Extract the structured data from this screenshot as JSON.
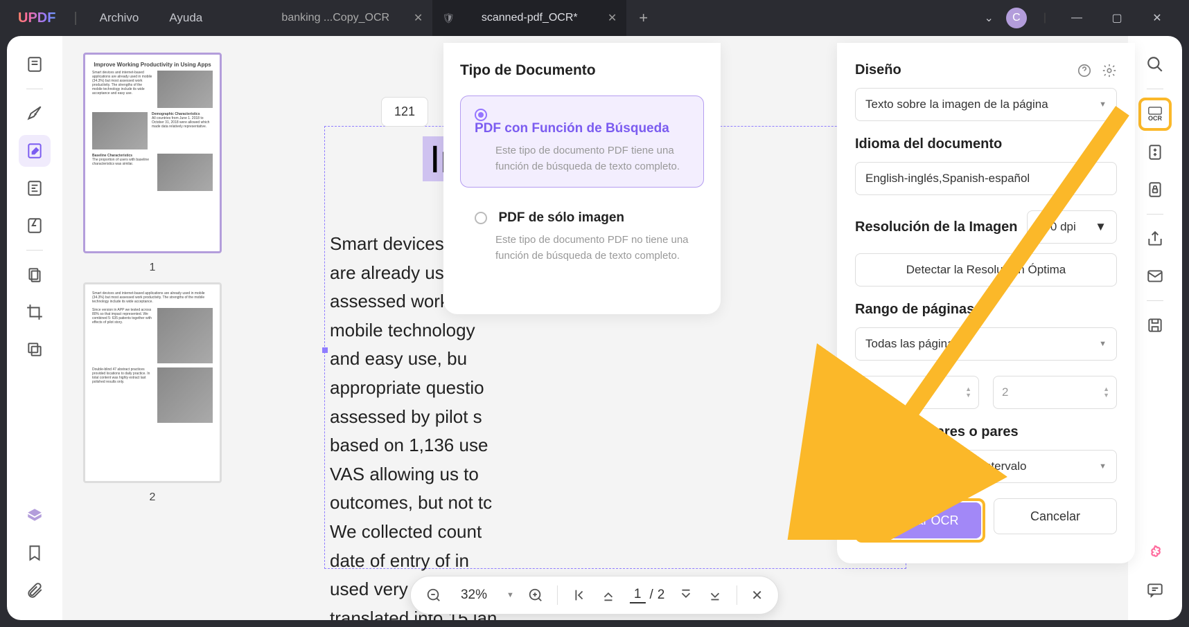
{
  "titlebar": {
    "logo": "UPDF",
    "menu": {
      "file": "Archivo",
      "help": "Ayuda"
    },
    "tabs": [
      {
        "label": "banking ...Copy_OCR",
        "active": false
      },
      {
        "label": "scanned-pdf_OCR*",
        "active": true
      }
    ],
    "avatar": "C"
  },
  "thumbnails": [
    {
      "page": "1",
      "title": "Improve Working Productivity in Using Apps"
    },
    {
      "page": "2",
      "title": ""
    }
  ],
  "document": {
    "page_badge": "121",
    "heading": "Im",
    "body": "Smart devices and\nare already used\nassessed work prod\nmobile technology\nand easy use, bu\nappropriate questio\nassessed by pilot s\nbased on 1,136 use\nVAS allowing us to\noutcomes, but not tc\nWe collected count\ndate of entry of in\nused very simple qu\ntranslated into 15 lan"
  },
  "doctype": {
    "heading": "Tipo de Documento",
    "options": [
      {
        "title": "PDF con Función de Búsqueda",
        "desc": "Este tipo de documento PDF tiene una función de búsqueda de texto completo."
      },
      {
        "title": "PDF de sólo imagen",
        "desc": "Este tipo de documento PDF no tiene una función de búsqueda de texto completo."
      }
    ]
  },
  "ocr": {
    "design_label": "Diseño",
    "design_value": "Texto sobre la imagen de la página",
    "lang_label": "Idioma del documento",
    "lang_value": "English-inglés,Spanish-español",
    "res_label": "Resolución de la Imagen",
    "res_value": "300 dpi",
    "detect": "Detectar la Resolución Óptima",
    "range_label": "Rango de páginas",
    "range_value": "Todas las páginas",
    "range_from": "1",
    "range_to": "2",
    "parity_label": "Páginas impares o pares",
    "parity_value": "Todas las páginas del intervalo",
    "run": "Ejecutar OCR",
    "cancel": "Cancelar"
  },
  "zoombar": {
    "zoom": "32%",
    "current": "1",
    "sep": "/",
    "total": "2"
  }
}
